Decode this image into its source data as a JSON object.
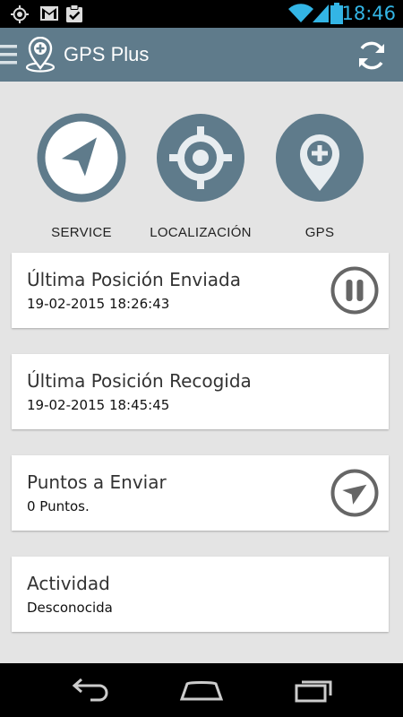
{
  "status_bar": {
    "time": "18:46",
    "icons": [
      "gps-fix-icon",
      "gmail-icon",
      "clipboard-check-icon",
      "wifi-icon",
      "signal-icon",
      "battery-icon"
    ]
  },
  "app_bar": {
    "title": "GPS Plus",
    "icons": [
      "drawer-menu-icon",
      "map-pin-plus-icon",
      "refresh-icon"
    ]
  },
  "actions": [
    {
      "label": "SERVICE",
      "icon": "navigation-arrow-icon"
    },
    {
      "label": "LOCALIZACIÓN",
      "icon": "crosshair-icon"
    },
    {
      "label": "GPS",
      "icon": "map-pin-plus-icon"
    }
  ],
  "cards": [
    {
      "title": "Última Posición Enviada",
      "value": "19-02-2015 18:26:43",
      "icon": "pause-icon"
    },
    {
      "title": "Última Posición Recogida",
      "value": "19-02-2015 18:45:45"
    },
    {
      "title": "Puntos a Enviar",
      "value": "0 Puntos.",
      "icon": "send-icon"
    },
    {
      "title": "Actividad",
      "value": "Desconocida"
    }
  ],
  "nav_bar": {
    "icons": [
      "back-icon",
      "home-icon",
      "recent-apps-icon"
    ]
  },
  "colors": {
    "primary": "#5f7b8b",
    "status_accent": "#33b5e5",
    "card_icon_gray": "#666666",
    "background": "#e4e4e4"
  }
}
